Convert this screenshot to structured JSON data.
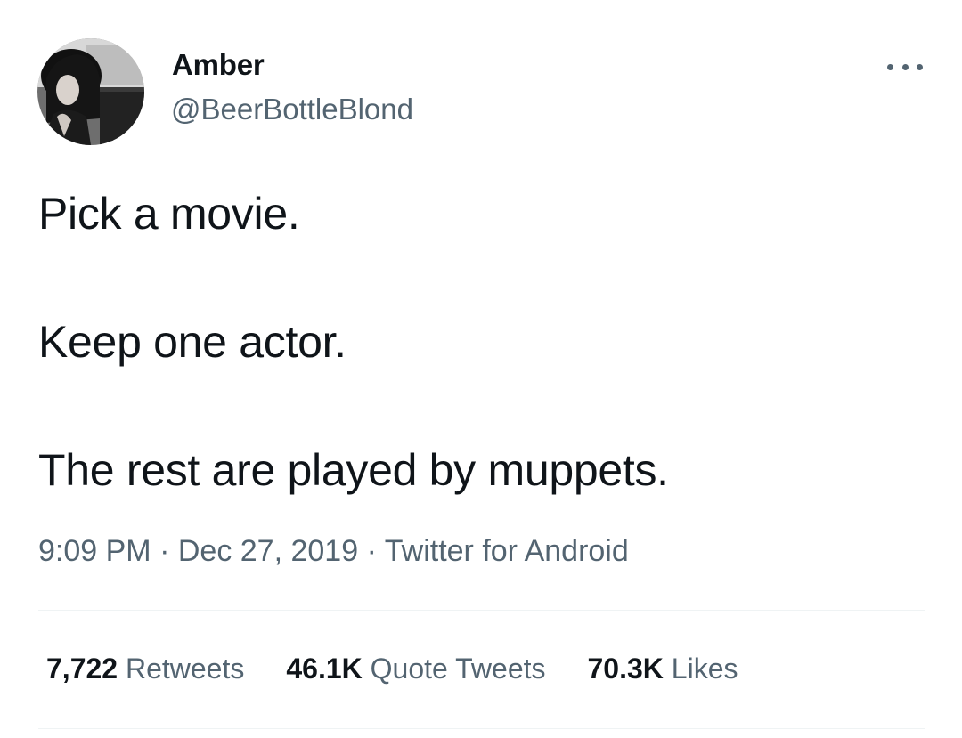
{
  "author": {
    "name": "Amber",
    "handle": "@BeerBottleBlond"
  },
  "tweet": {
    "lines": [
      "Pick a movie.",
      "Keep one actor.",
      "The rest are played by muppets."
    ],
    "time": "9:09 PM",
    "date": "Dec 27, 2019",
    "source": "Twitter for Android",
    "separator": "·"
  },
  "stats": {
    "retweets_count": "7,722",
    "retweets_label": "Retweets",
    "quotes_count": "46.1K",
    "quotes_label": "Quote Tweets",
    "likes_count": "70.3K",
    "likes_label": "Likes"
  },
  "icons": {
    "more": "more-horizontal-icon"
  },
  "colors": {
    "text": "#0f1419",
    "secondary": "#536471",
    "divider": "#eff3f4"
  }
}
